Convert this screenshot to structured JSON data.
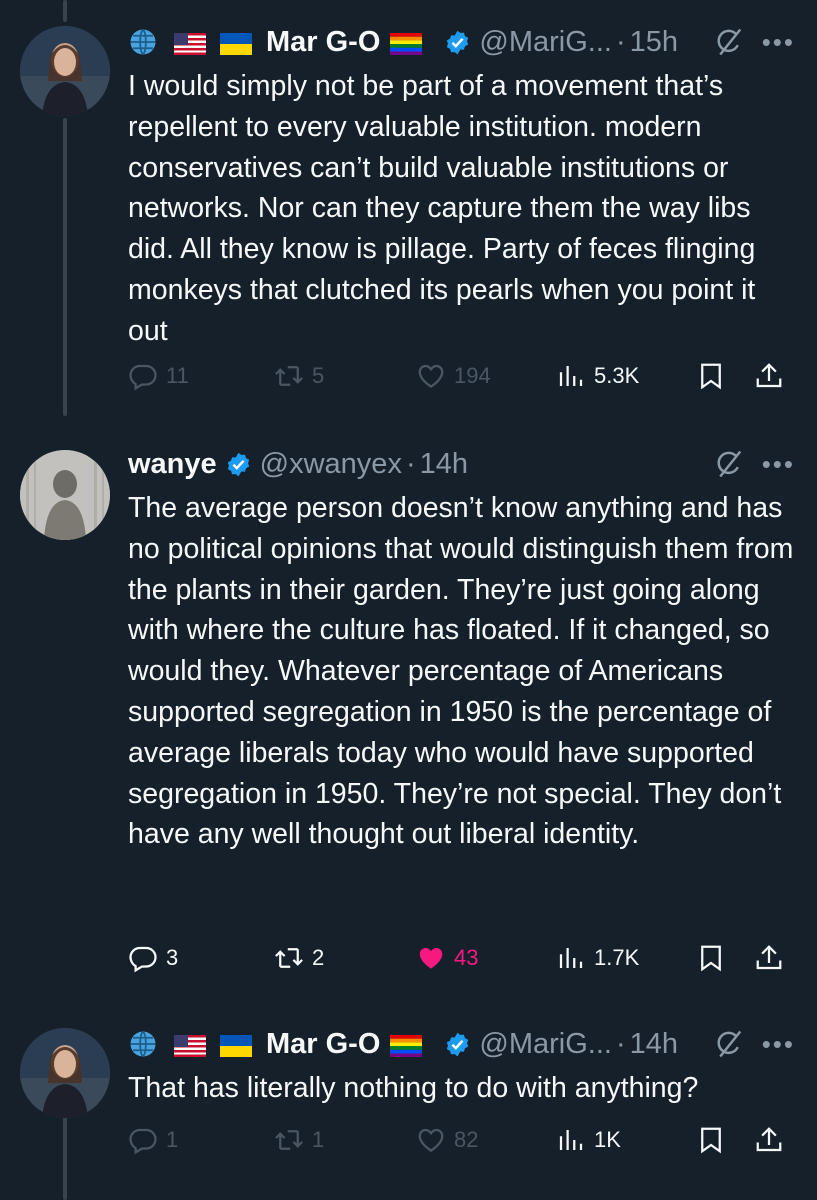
{
  "tweets": [
    {
      "name": "Mar G-O",
      "handle": "@MariG...",
      "time": "15h",
      "text": "I would simply not be part of a movement that’s repellent to every valuable institution. modern conservatives can’t build valuable institutions or networks. Nor can they capture them the way libs did. All they know is pillage. Party of feces flinging monkeys that clutched its pearls when you point it out",
      "replies": "11",
      "reposts": "5",
      "likes": "194",
      "views": "5.3K"
    },
    {
      "name": "wanye",
      "handle": "@xwanyex",
      "time": "14h",
      "text": "The average person doesn’t know anything and has no political opinions that would distinguish them from the plants in their garden. They’re just going along with where the culture has floated. If it changed, so would they. Whatever percentage of Americans supported segregation in 1950 is the percentage of average liberals today who would have supported segregation in 1950. They’re not special. They don’t have any well thought out liberal identity.",
      "replies": "3",
      "reposts": "2",
      "likes": "43",
      "views": "1.7K"
    },
    {
      "name": "Mar G-O",
      "handle": "@MariG...",
      "time": "14h",
      "text": "That has literally nothing to do with anything?",
      "replies": "1",
      "reposts": "1",
      "likes": "82",
      "views": "1K"
    }
  ],
  "icons": [
    "globe-emoji",
    "us-flag-emoji",
    "ukraine-flag-emoji",
    "rainbow-flag-emoji",
    "verified-badge-icon",
    "grok-icon",
    "more-icon",
    "reply-icon",
    "repost-icon",
    "like-icon",
    "views-icon",
    "bookmark-icon",
    "share-icon"
  ],
  "colors": {
    "background": "#15202b",
    "text": "#f7f9f9",
    "secondary": "#8b98a5",
    "verified": "#1d9bf0",
    "like_active": "#f91880"
  }
}
